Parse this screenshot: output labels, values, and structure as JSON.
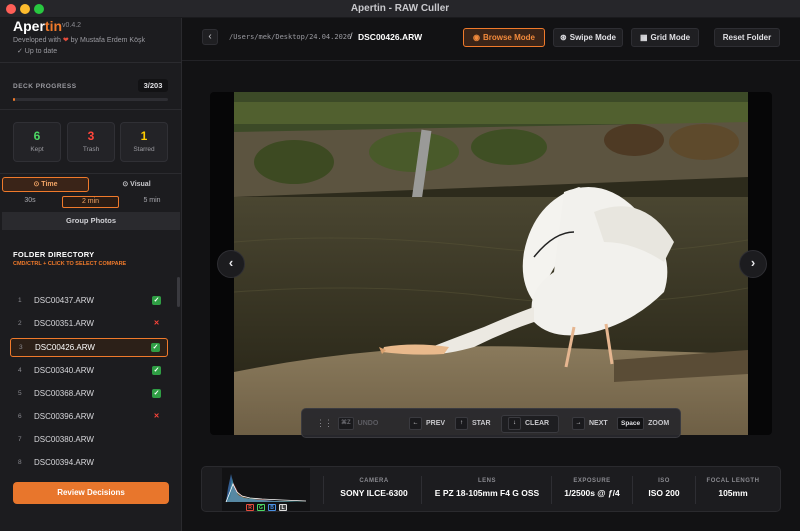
{
  "window": {
    "title": "Apertin - RAW Culler"
  },
  "brand": {
    "name_a": "Aper",
    "name_b": "tin",
    "version": "v0.4.2",
    "developed_prefix": "Developed with",
    "developed_by": "by Mustafa Erdem Köşk",
    "update_status": "✓ Up to date"
  },
  "deck": {
    "label": "DECK PROGRESS",
    "count": "3/203",
    "progress": 0.0148
  },
  "stats": {
    "kept": {
      "value": "6",
      "label": "Kept"
    },
    "trash": {
      "value": "3",
      "label": "Trash"
    },
    "starred": {
      "value": "1",
      "label": "Starred"
    }
  },
  "grouping": {
    "time_label": "⊙ Time",
    "visual_label": "⊙ Visual",
    "intervals": [
      "30s",
      "2 min",
      "5 min"
    ],
    "selected_interval": "2 min",
    "group_button": "Group Photos"
  },
  "folder": {
    "title": "FOLDER DIRECTORY",
    "hint": "CMD/CTRL + CLICK TO SELECT COMPARE",
    "files": [
      {
        "index": "1",
        "name": "DSC00437.ARW",
        "status": "kept"
      },
      {
        "index": "2",
        "name": "DSC00351.ARW",
        "status": "trash"
      },
      {
        "index": "3",
        "name": "DSC00426.ARW",
        "status": "kept"
      },
      {
        "index": "4",
        "name": "DSC00340.ARW",
        "status": "kept"
      },
      {
        "index": "5",
        "name": "DSC00368.ARW",
        "status": "kept"
      },
      {
        "index": "6",
        "name": "DSC00396.ARW",
        "status": "trash"
      },
      {
        "index": "7",
        "name": "DSC00380.ARW",
        "status": ""
      },
      {
        "index": "8",
        "name": "DSC00394.ARW",
        "status": ""
      },
      {
        "index": "9",
        "name": "DSC00343.ARW",
        "status": ""
      }
    ],
    "active_index": 2
  },
  "review_button": "Review Decisions",
  "toolbar": {
    "path": "/Users/mek/Desktop/24.04.2026",
    "separator": "/",
    "current_file": "DSC00426.ARW",
    "browse": "Browse Mode",
    "swipe": "Swipe Mode",
    "grid": "Grid Mode",
    "reset": "Reset Folder"
  },
  "shortcuts": {
    "undo_key": "⌘Z",
    "undo": "UNDO",
    "prev_key": "←",
    "prev": "PREV",
    "star_key": "↑",
    "star": "STAR",
    "clear_key": "↓",
    "clear": "CLEAR",
    "next_key": "→",
    "next": "NEXT",
    "zoom_key": "Space",
    "zoom": "ZOOM"
  },
  "histogram": {
    "channels": [
      "R",
      "G",
      "B",
      "L"
    ]
  },
  "metadata": {
    "camera_label": "CAMERA",
    "camera": "SONY ILCE-6300",
    "lens_label": "LENS",
    "lens": "E PZ 18-105mm F4 G OSS",
    "exposure_label": "EXPOSURE",
    "exposure": "1/2500s @ ƒ/4",
    "iso_label": "ISO",
    "iso": "ISO 200",
    "focal_label": "FOCAL LENGTH",
    "focal": "105mm"
  },
  "colors": {
    "accent": "#f07a2b",
    "kept": "#4cd964",
    "trash": "#ff453a",
    "starred": "#ffcc00"
  }
}
